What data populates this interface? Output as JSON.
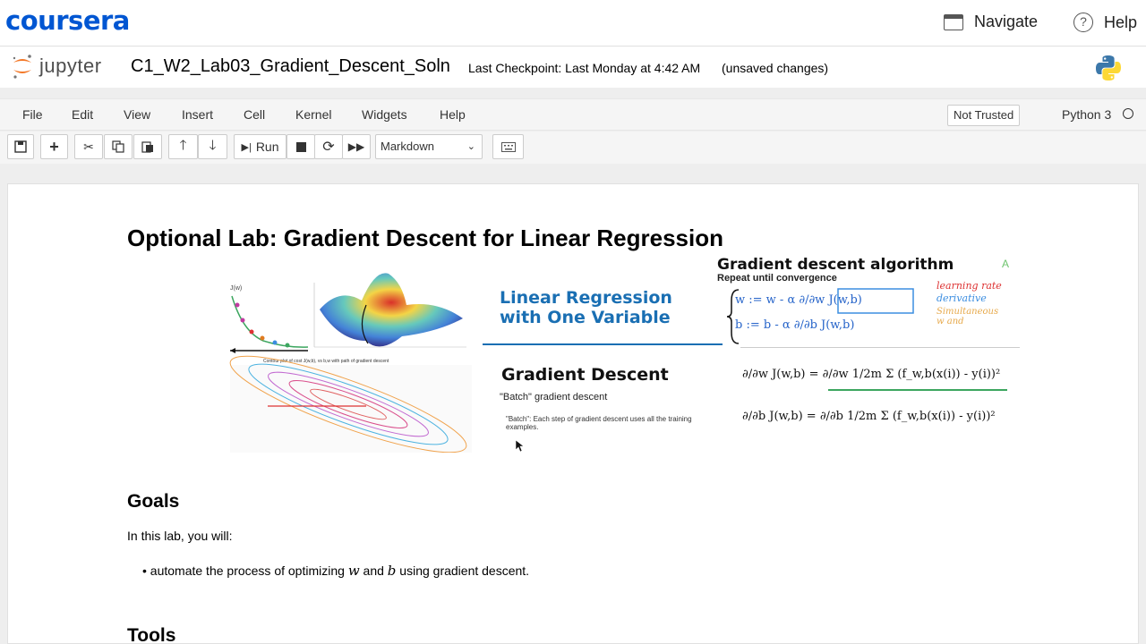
{
  "coursera": {
    "logo": "coursera",
    "nav": [
      {
        "label": "Navigate",
        "icon": "window-icon"
      },
      {
        "label": "Help",
        "icon": "question-icon"
      }
    ]
  },
  "jupyter": {
    "logo_text": "jupyter",
    "notebook_name": "C1_W2_Lab03_Gradient_Descent_Soln",
    "checkpoint": "Last Checkpoint: Last Monday at 4:42 AM",
    "unsaved": "(unsaved changes)"
  },
  "menu": {
    "items": [
      "File",
      "Edit",
      "View",
      "Insert",
      "Cell",
      "Kernel",
      "Widgets",
      "Help"
    ],
    "trust": "Not Trusted",
    "kernel": "Python 3"
  },
  "toolbar": {
    "run_label": "Run",
    "cell_type": "Markdown"
  },
  "notebook": {
    "title": "Optional Lab: Gradient Descent for Linear Regression",
    "goals_heading": "Goals",
    "goals_intro": "In this lab, you will:",
    "goal_prefix": "automate the process of optimizing ",
    "goal_w": "w",
    "goal_and": " and ",
    "goal_b": "b",
    "goal_suffix": " using gradient descent.",
    "tools_heading": "Tools"
  },
  "banner": {
    "lr_title": "Linear Regression with One Variable",
    "gd_title": "Gradient Descent",
    "gd_sub": "\"Batch\" gradient descent",
    "gd_note": "\"Batch\": Each step of gradient descent uses all the training examples.",
    "alg_title": "Gradient descent algorithm",
    "alg_sub": "Repeat until convergence",
    "alg_a": "A",
    "learning_rate": "learning rate",
    "derivative": "derivative",
    "simultaneous": "Simultaneous",
    "simultaneous_2": "w and",
    "contour_caption": "Contour plot of cost J(w,b), vs b,w with path of gradient descent",
    "eq1": "w := w - α ∂/∂w J(w,b)",
    "eq2": "b := b - α ∂/∂b J(w,b)",
    "eq3": "∂/∂w J(w,b) = ∂/∂w 1/2m Σ (f_w,b(x(i)) - y(i))²",
    "eq4": "∂/∂b J(w,b) = ∂/∂b 1/2m Σ (f_w,b(x(i)) - y(i))²"
  },
  "colors": {
    "coursera_blue": "#0056d2",
    "jupyter_orange": "#f37726",
    "lr_blue": "#1a6fb3"
  }
}
